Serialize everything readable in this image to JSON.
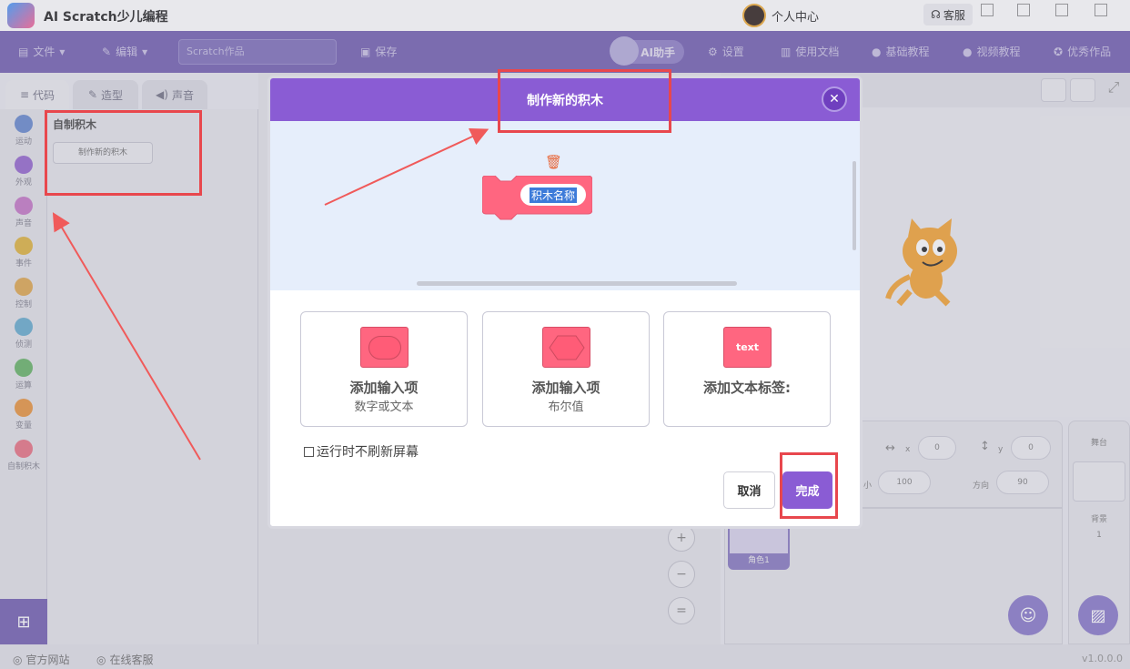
{
  "titlebar": {
    "app_title": "AI Scratch少儿编程",
    "user_center": "个人中心",
    "service": "客服"
  },
  "menubar": {
    "file": "文件",
    "edit": "编辑",
    "project_placeholder": "Scratch作品",
    "save": "保存",
    "ai_helper": "AI助手",
    "settings": "设置",
    "docs": "使用文档",
    "basic_tutorial": "基础教程",
    "video_tutorial": "视频教程",
    "featured": "优秀作品"
  },
  "tabs": {
    "code": "代码",
    "costumes": "造型",
    "sounds": "声音"
  },
  "categories": [
    {
      "label": "运动",
      "color": "#6f8fd0"
    },
    {
      "label": "外观",
      "color": "#9a6fd0"
    },
    {
      "label": "声音",
      "color": "#c77fc9"
    },
    {
      "label": "事件",
      "color": "#e0b84a"
    },
    {
      "label": "控制",
      "color": "#e0ac5a"
    },
    {
      "label": "侦测",
      "color": "#6fb0d0"
    },
    {
      "label": "运算",
      "color": "#6fb86f"
    },
    {
      "label": "变量",
      "color": "#e89a4a"
    },
    {
      "label": "自制积木",
      "color": "#e87a8a"
    }
  ],
  "palette": {
    "title": "自制积木",
    "make_block": "制作新的积木"
  },
  "workspace": {
    "zoom_in": "+",
    "zoom_out": "−",
    "zoom_reset": "="
  },
  "sprite_info": {
    "x_label": "x",
    "x_value": "0",
    "y_label": "y",
    "y_value": "0",
    "size_label": "小",
    "size_value": "100",
    "direction_label": "方向",
    "direction_value": "90"
  },
  "sprite_list": {
    "sprite_name": "角色1"
  },
  "stage_panel": {
    "title": "舞台",
    "backdrops_label": "背景",
    "backdrops_count": "1"
  },
  "statusbar": {
    "website": "官方网站",
    "online_service": "在线客服",
    "version": "v1.0.0.0"
  },
  "modal": {
    "title": "制作新的积木",
    "block_name": "积木名称",
    "options": [
      {
        "title": "添加输入项",
        "sub": "数字或文本"
      },
      {
        "title": "添加输入项",
        "sub": "布尔值"
      },
      {
        "title": "添加文本标签:",
        "sub": "",
        "icon_text": "text"
      }
    ],
    "run_without_refresh": "运行时不刷新屏幕",
    "cancel": "取消",
    "done": "完成"
  },
  "colors": {
    "menubar": "#7a68b5",
    "modal_header": "#8a5cd4",
    "block_pink": "#ff6680",
    "annotation_red": "#e8474d"
  }
}
